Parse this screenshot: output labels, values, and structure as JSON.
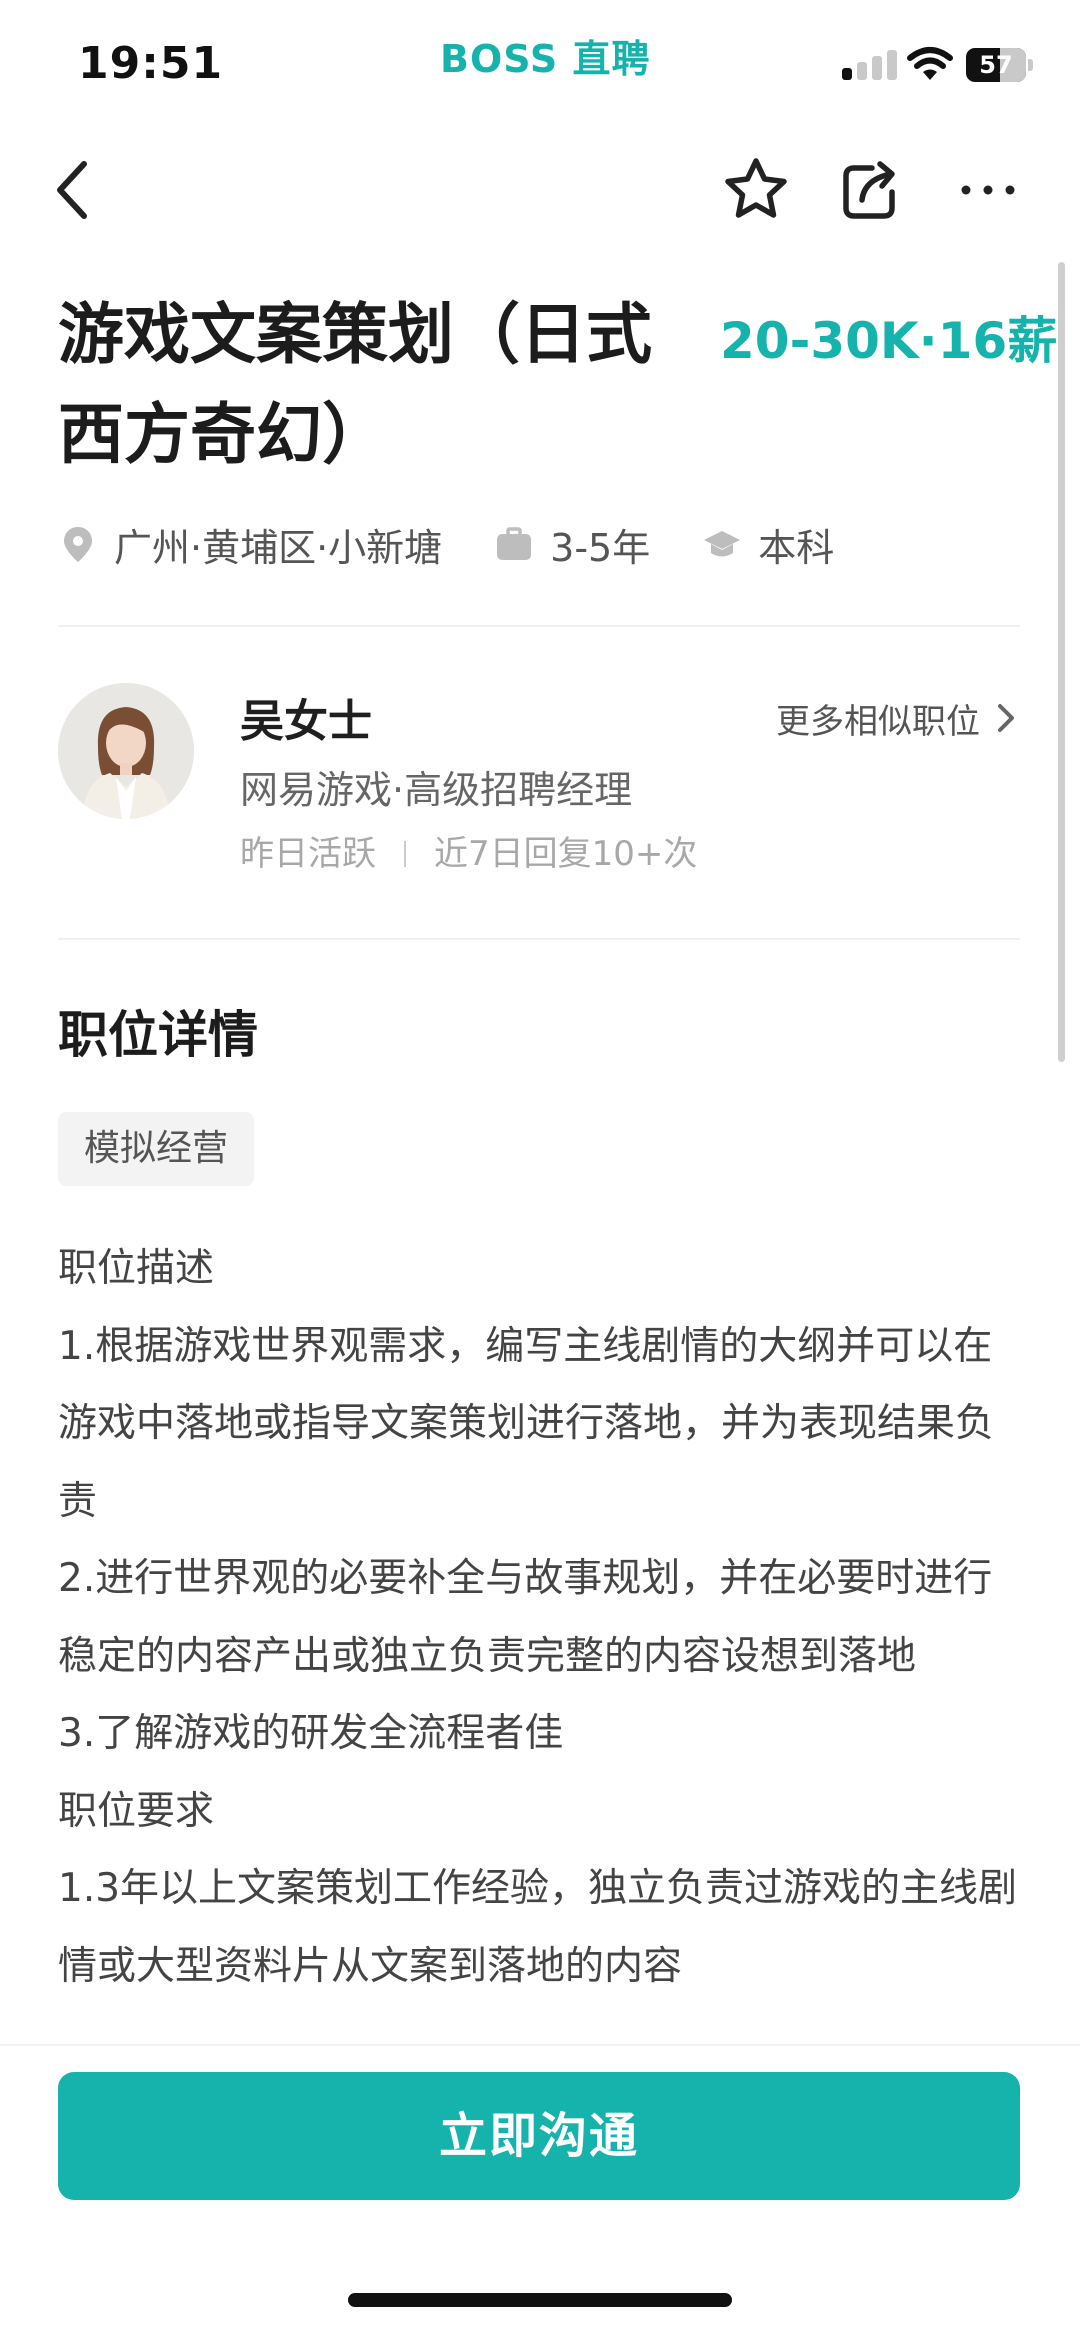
{
  "status_bar": {
    "time": "19:51",
    "app_brand": "BOSS 直聘",
    "battery_level": "57",
    "signal_bars_active": 1,
    "signal_bars_total": 4
  },
  "nav": {
    "icons": [
      "back-chevron-icon",
      "star-icon",
      "share-icon",
      "more-dots-icon"
    ]
  },
  "job": {
    "title": "游戏文案策划（日式西方奇幻）",
    "salary": "20-30K·16薪",
    "location": "广州·黄埔区·小新塘",
    "experience": "3-5年",
    "education": "本科"
  },
  "recruiter": {
    "name": "吴女士",
    "company_position": "网易游戏·高级招聘经理",
    "active": "昨日活跃",
    "reply": "近7日回复10+次",
    "more_similar": "更多相似职位"
  },
  "details": {
    "section_title": "职位详情",
    "tag": "模拟经营",
    "paragraphs": [
      "职位描述",
      "1.根据游戏世界观需求，编写主线剧情的大纲并可以在游戏中落地或指导文案策划进行落地，并为表现结果负责",
      "2.进行世界观的必要补全与故事规划，并在必要时进行稳定的内容产出或独立负责完整的内容设想到落地",
      "3.了解游戏的研发全流程者佳",
      "职位要求",
      "1.3年以上文案策划工作经验，独立负责过游戏的主线剧情或大型资料片从文案到落地的内容"
    ]
  },
  "bottom": {
    "chat_button": "立即沟通"
  },
  "colors": {
    "accent": "#16b3ad",
    "title": "#1c1c1c",
    "muted": "#a8a8a8"
  }
}
